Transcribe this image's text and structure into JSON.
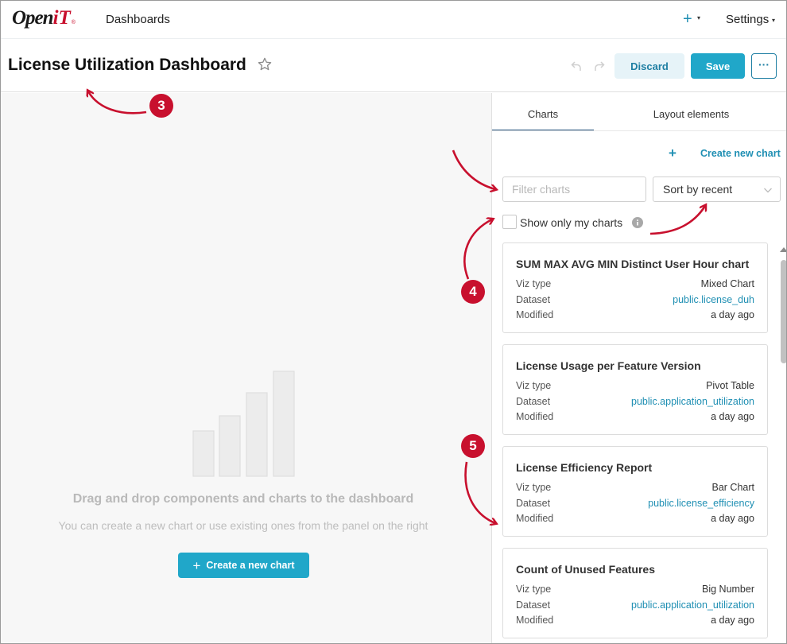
{
  "topnav": {
    "logo_main": "Open",
    "logo_accent": "iT",
    "logo_mark": "®",
    "dashboards_label": "Dashboards",
    "plus_label": "+",
    "settings_label": "Settings"
  },
  "header": {
    "title": "License Utilization Dashboard",
    "discard_label": "Discard",
    "save_label": "Save",
    "more_label": "···"
  },
  "canvas": {
    "empty_title": "Drag and drop components and charts to the dashboard",
    "empty_subtitle": "You can create a new chart or use existing ones from the panel on the right",
    "create_button_label": "Create a new chart"
  },
  "panel": {
    "tabs": [
      {
        "label": "Charts",
        "active": true
      },
      {
        "label": "Layout elements",
        "active": false
      }
    ],
    "create_new_chart": "Create new chart",
    "filter_placeholder": "Filter charts",
    "sort_value": "Sort by recent",
    "show_only_mine": "Show only my charts",
    "charts": [
      {
        "title": "SUM MAX AVG MIN Distinct User Hour chart",
        "viz_label": "Viz type",
        "viz": "Mixed Chart",
        "dataset_label": "Dataset",
        "dataset": "public.license_duh",
        "modified_label": "Modified",
        "modified": "a day ago"
      },
      {
        "title": "License Usage per Feature Version",
        "viz_label": "Viz type",
        "viz": "Pivot Table",
        "dataset_label": "Dataset",
        "dataset": "public.application_utilization",
        "modified_label": "Modified",
        "modified": "a day ago"
      },
      {
        "title": "License Efficiency Report",
        "viz_label": "Viz type",
        "viz": "Bar Chart",
        "dataset_label": "Dataset",
        "dataset": "public.license_efficiency",
        "modified_label": "Modified",
        "modified": "a day ago"
      },
      {
        "title": "Count of Unused Features",
        "viz_label": "Viz type",
        "viz": "Big Number",
        "dataset_label": "Dataset",
        "dataset": "public.application_utilization",
        "modified_label": "Modified",
        "modified": "a day ago"
      }
    ]
  },
  "annotations": {
    "badge_3": "3",
    "badge_4": "4",
    "badge_5": "5",
    "color": "#c8102e"
  },
  "colors": {
    "accent": "#20a7c9",
    "link": "#1f8fb3",
    "brand_red": "#c8102e"
  }
}
